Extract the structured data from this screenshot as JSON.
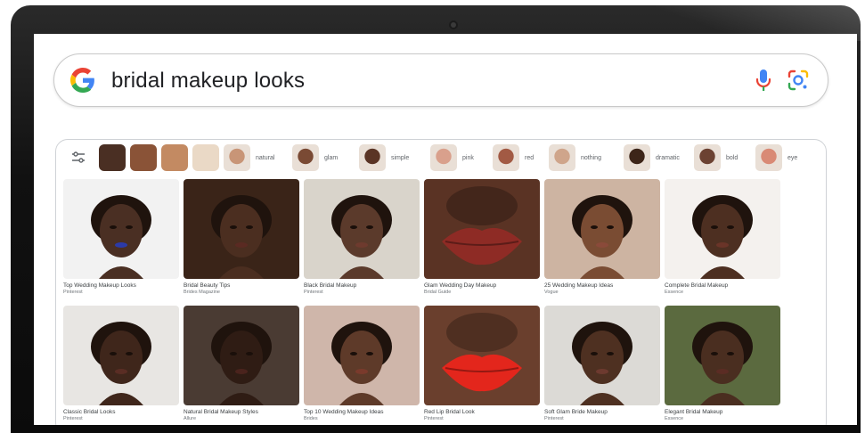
{
  "search": {
    "query": "bridal makeup looks",
    "colors": {
      "g_blue": "#4285F4",
      "g_red": "#EA4335",
      "g_yellow": "#FBBC05",
      "g_green": "#34A853"
    }
  },
  "filters": {
    "swatches": [
      "#4a2f23",
      "#8a5337",
      "#c38a62",
      "#ead9c6"
    ],
    "chips": [
      {
        "label": "natural",
        "tone": "#c89577"
      },
      {
        "label": "glam",
        "tone": "#7a4a34"
      },
      {
        "label": "simple",
        "tone": "#5a3425"
      },
      {
        "label": "pink",
        "tone": "#d9a08c"
      },
      {
        "label": "red",
        "tone": "#a25a44"
      },
      {
        "label": "nothing",
        "tone": "#cfa58b"
      },
      {
        "label": "dramatic",
        "tone": "#3d2519"
      },
      {
        "label": "bold",
        "tone": "#6c4232"
      },
      {
        "label": "eye",
        "tone": "#d98a75"
      }
    ]
  },
  "results": [
    {
      "caption": "Top Wedding Makeup Looks",
      "source": "Pinterest",
      "bg": "#f2f2f2",
      "skin": "#4a2f23",
      "lip": "#2b3aa8"
    },
    {
      "caption": "Bridal Beauty Tips",
      "source": "Brides Magazine",
      "bg": "#3a2418",
      "skin": "#4b2e20",
      "lip": "#5a2a22"
    },
    {
      "caption": "Black Bridal Makeup",
      "source": "Pinterest",
      "bg": "#d9d4cb",
      "skin": "#5b3a2b",
      "lip": "#6e3a2e"
    },
    {
      "caption": "Glam Wedding Day Makeup",
      "source": "Bridal Guide",
      "bg": "#2e1a12",
      "skin": "#5a3324",
      "lip": "#8e2b25"
    },
    {
      "caption": "25 Wedding Makeup Ideas",
      "source": "Vogue",
      "bg": "#cdb4a2",
      "skin": "#7a4c33",
      "lip": "#8a4a3a"
    },
    {
      "caption": "Complete Bridal Makeup",
      "source": "Essence",
      "bg": "#f4f1ee",
      "skin": "#4d2f21",
      "lip": "#6a3428"
    },
    {
      "caption": "Classic Bridal Looks",
      "source": "Pinterest",
      "bg": "#e8e6e3",
      "skin": "#3f261b",
      "lip": "#5a2d24"
    },
    {
      "caption": "Natural Bridal Makeup Styles",
      "source": "Allure",
      "bg": "#4a3b33",
      "skin": "#2f1c14",
      "lip": "#4a231d"
    },
    {
      "caption": "Top 10 Wedding Makeup Ideas",
      "source": "Brides",
      "bg": "#cfb6aa",
      "skin": "#5e3a29",
      "lip": "#7a3a2c"
    },
    {
      "caption": "Red Lip Bridal Look",
      "source": "Pinterest",
      "bg": "#6a3f2d",
      "skin": "#6a3f2d",
      "lip": "#e3261c"
    },
    {
      "caption": "Soft Glam Bride Makeup",
      "source": "Pinterest",
      "bg": "#dcdad6",
      "skin": "#4e3021",
      "lip": "#6d3a2f"
    },
    {
      "caption": "Elegant Bridal Makeup",
      "source": "Essence",
      "bg": "#5b6a3f",
      "skin": "#4a2e20",
      "lip": "#5b2c24"
    }
  ]
}
